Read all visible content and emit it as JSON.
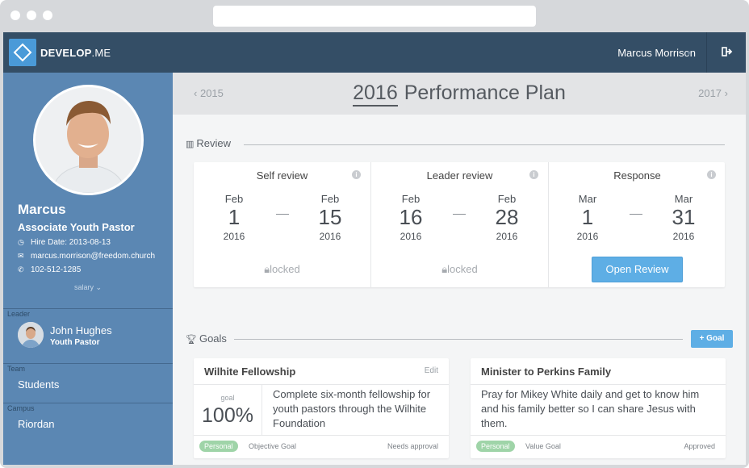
{
  "brand": {
    "name_bold": "DEVELOP",
    "name_rest": ".ME"
  },
  "topbar": {
    "user_name": "Marcus Morrison"
  },
  "profile": {
    "name": "Marcus",
    "role": "Associate Youth Pastor",
    "hire_date": "Hire Date: 2013-08-13",
    "email": "marcus.morrison@freedom.church",
    "phone": "102-512-1285",
    "salary_toggle": "salary"
  },
  "leader": {
    "label": "Leader",
    "name": "John Hughes",
    "role": "Youth Pastor"
  },
  "team": {
    "label": "Team",
    "value": "Students"
  },
  "campus": {
    "label": "Campus",
    "value": "Riordan"
  },
  "header": {
    "prev": "2015",
    "year": "2016",
    "title": "Performance Plan",
    "next": "2017"
  },
  "review_section": {
    "label": "Review"
  },
  "reviews": [
    {
      "title": "Self review",
      "from": {
        "m": "Feb",
        "d": "1",
        "y": "2016"
      },
      "to": {
        "m": "Feb",
        "d": "15",
        "y": "2016"
      },
      "status": "locked"
    },
    {
      "title": "Leader review",
      "from": {
        "m": "Feb",
        "d": "16",
        "y": "2016"
      },
      "to": {
        "m": "Feb",
        "d": "28",
        "y": "2016"
      },
      "status": "locked"
    },
    {
      "title": "Response",
      "from": {
        "m": "Mar",
        "d": "1",
        "y": "2016"
      },
      "to": {
        "m": "Mar",
        "d": "31",
        "y": "2016"
      },
      "action": "Open Review"
    }
  ],
  "goals_section": {
    "label": "Goals",
    "add_label": "+ Goal"
  },
  "goals": [
    {
      "title": "Wilhite Fellowship",
      "edit": "Edit",
      "goal_label": "goal",
      "percent": "100%",
      "description": "Complete six-month fellowship for youth pastors through the Wilhite Foundation",
      "tag": "Personal",
      "type": "Objective Goal",
      "status": "Needs approval"
    },
    {
      "title": "Minister to Perkins Family",
      "description": "Pray for Mikey White daily and get to know him and his family better so I can share Jesus with them.",
      "tag": "Personal",
      "type": "Value Goal",
      "status": "Approved"
    }
  ],
  "colors": {
    "topbar": "#344e66",
    "sidebar": "#5b87b3",
    "accent": "#5eaee5",
    "tag": "#9fd4a8"
  }
}
